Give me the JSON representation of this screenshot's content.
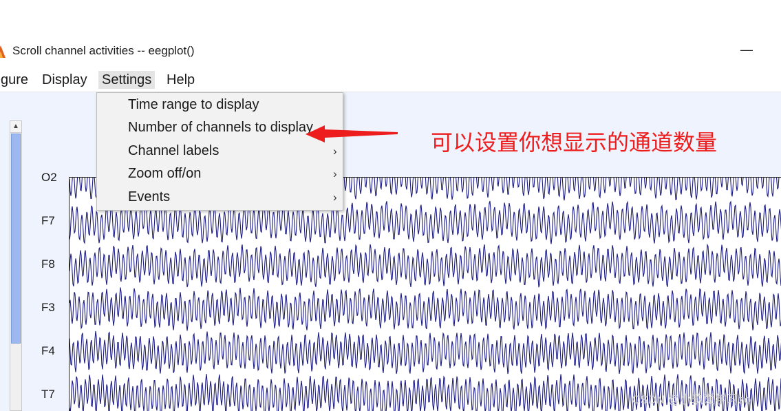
{
  "window": {
    "title": "Scroll channel activities -- eegplot()",
    "minimize_glyph": "—"
  },
  "menubar": {
    "items": [
      "gure",
      "Display",
      "Settings",
      "Help"
    ],
    "active": "Settings"
  },
  "settings_menu": {
    "items": [
      {
        "label": "Time range to display",
        "submenu": false
      },
      {
        "label": "Number of channels to display",
        "submenu": false
      },
      {
        "label": "Channel labels",
        "submenu": true
      },
      {
        "label": "Zoom off/on",
        "submenu": true
      },
      {
        "label": "Events",
        "submenu": true
      }
    ],
    "submenu_glyph": "›"
  },
  "channels": [
    "O2",
    "F7",
    "F8",
    "F3",
    "F4",
    "T7"
  ],
  "scrollbar": {
    "up_glyph": "▲"
  },
  "annotation": {
    "text": "可以设置你想显示的通道数量",
    "color": "#ee1d1d"
  },
  "watermark": "CSDN @小玖爱学习zo",
  "colors": {
    "trace": "#1a1a80",
    "annotation": "#ee1d1d",
    "scroll_thumb": "#9db8f0",
    "client_bg": "#eef3fd"
  }
}
